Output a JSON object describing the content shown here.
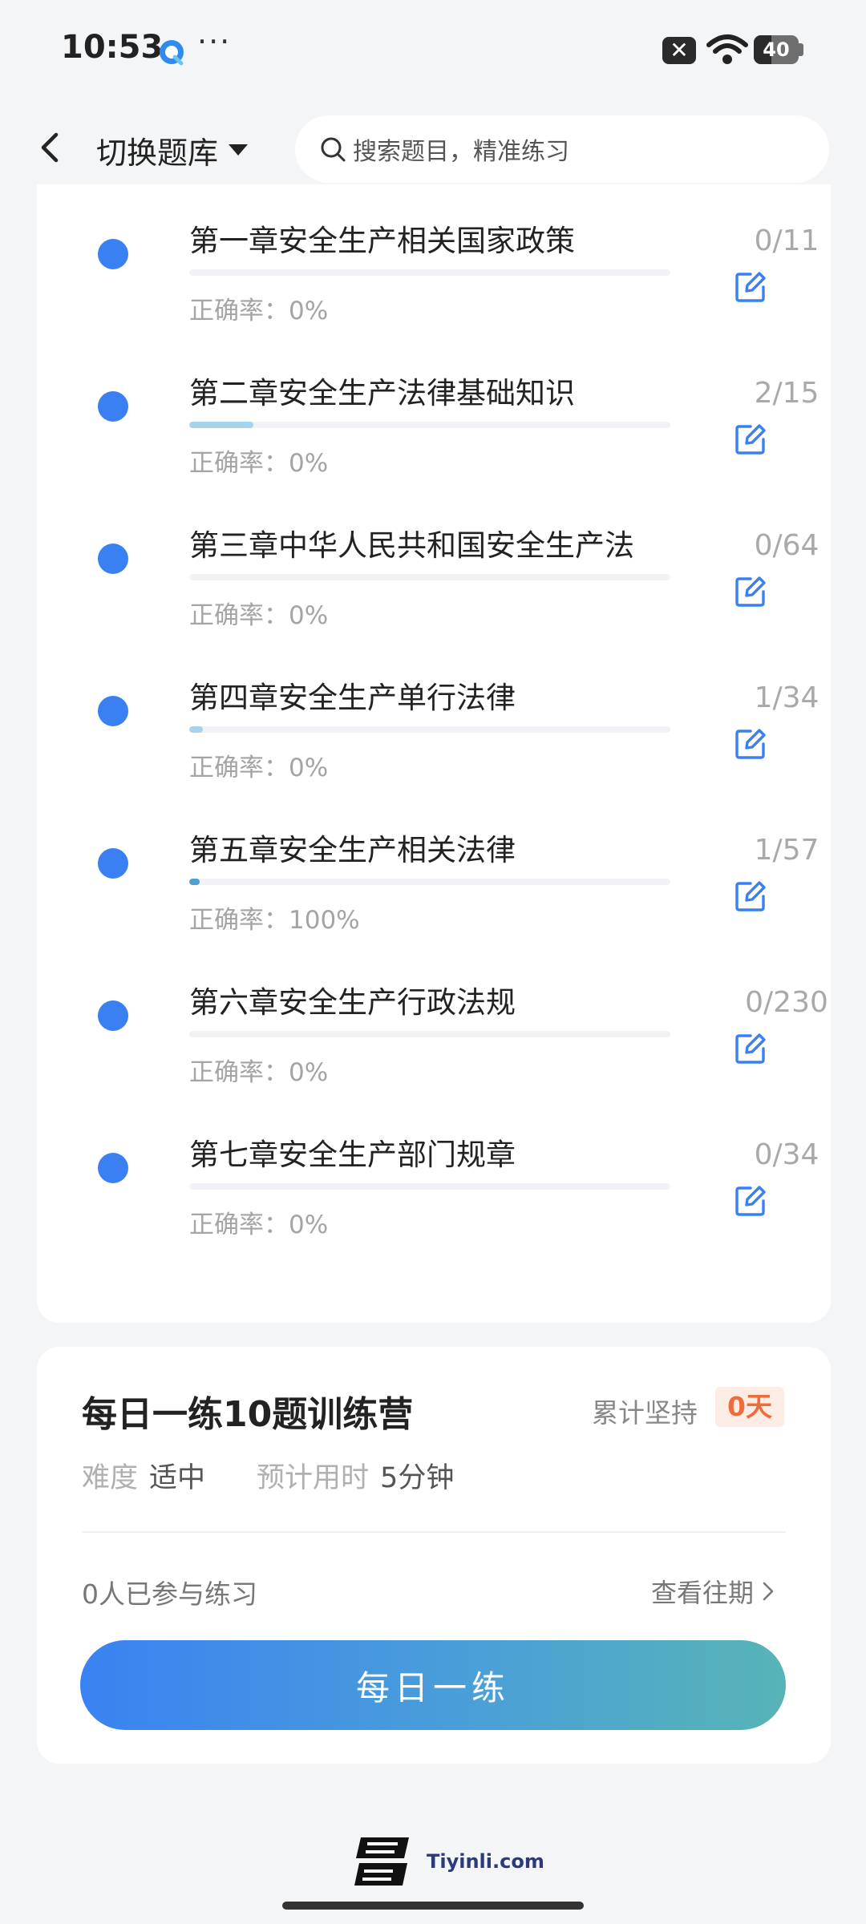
{
  "status_bar": {
    "time": "10:53",
    "dots": "···",
    "close_glyph": "✕",
    "battery": "40"
  },
  "header": {
    "bank_switch_label": "切换题库",
    "search_placeholder": "搜索题目，精准练习"
  },
  "chapters": [
    {
      "title": "第一章安全生产相关国家政策",
      "count": "0/11",
      "accuracy_label": "正确率：",
      "accuracy": "0%",
      "progress": 0.0
    },
    {
      "title": "第二章安全生产法律基础知识",
      "count": "2/15",
      "accuracy_label": "正确率：",
      "accuracy": "0%",
      "progress": 0.133
    },
    {
      "title": "第三章中华人民共和国安全生产法",
      "count": "0/64",
      "accuracy_label": "正确率：",
      "accuracy": "0%",
      "progress": 0.0
    },
    {
      "title": "第四章安全生产单行法律",
      "count": "1/34",
      "accuracy_label": "正确率：",
      "accuracy": "0%",
      "progress": 0.029
    },
    {
      "title": "第五章安全生产相关法律",
      "count": "1/57",
      "accuracy_label": "正确率：",
      "accuracy": "100%",
      "progress": 0.018
    },
    {
      "title": "第六章安全生产行政法规",
      "count": "0/230",
      "accuracy_label": "正确率：",
      "accuracy": "0%",
      "progress": 0.0
    },
    {
      "title": "第七章安全生产部门规章",
      "count": "0/34",
      "accuracy_label": "正确率：",
      "accuracy": "0%",
      "progress": 0.0
    }
  ],
  "daily": {
    "title": "每日一练10题训练营",
    "streak_label": "累计坚持",
    "streak_value": "0天",
    "difficulty_label": "难度",
    "difficulty_value": "适中",
    "time_label": "预计用时",
    "time_value": "5分钟",
    "participants": "0人已参与练习",
    "history_link": "查看往期",
    "button": "每日一练"
  },
  "footer": {
    "domain": "Tiyinli.com"
  },
  "colors": {
    "accent": "#3a80f3",
    "progress": "#a5d3ee",
    "streak": "#f06b3b"
  },
  "icons": [
    "back-icon",
    "caret-down-icon",
    "search-icon",
    "edit-icon",
    "chevron-right-icon",
    "wifi-icon",
    "battery-icon",
    "close-icon"
  ]
}
